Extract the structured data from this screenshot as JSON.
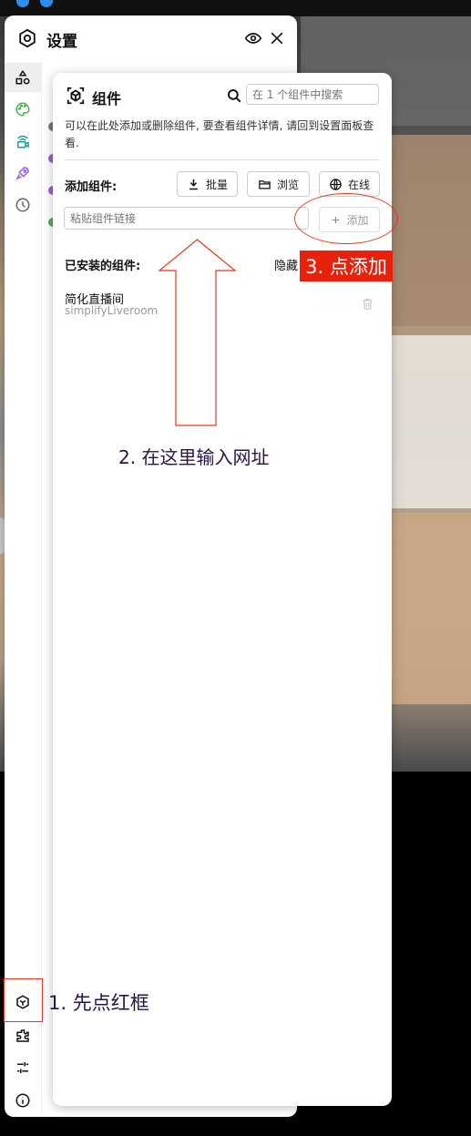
{
  "settings": {
    "title": "设置"
  },
  "components": {
    "title": "组件",
    "search_placeholder": "在 1 个组件中搜索",
    "description": "可以在此处添加或删除组件, 要查看组件详情, 请回到设置面板查看.",
    "add_label": "添加组件:",
    "buttons": {
      "batch": "批量",
      "browse": "浏览",
      "online": "在线"
    },
    "link_placeholder": "粘贴组件链接",
    "add_button": "添加",
    "installed_label": "已安装的组件:",
    "hide_label": "隐藏",
    "installed": [
      {
        "name": "简化直播间",
        "id": "simplifyLiveroom"
      }
    ]
  },
  "annotations": {
    "step1": "1. 先点红框",
    "step2": "2. 在这里输入网址",
    "step3": "3. 点添加"
  },
  "colors": {
    "annotation_red": "#e8210b",
    "annotation_text": "#2a1445",
    "nav_palette": "#4caf50",
    "nav_live": "#0aa38f",
    "nav_rocket": "#9c5ce6"
  },
  "icons": {
    "settings": "hexagon-gear-icon",
    "eye": "eye-icon",
    "close": "close-icon",
    "components": "cube-icon",
    "search": "search-icon",
    "download": "download-icon",
    "folder": "folder-icon",
    "globe": "globe-icon",
    "plus": "plus-icon",
    "trash": "trash-icon"
  }
}
